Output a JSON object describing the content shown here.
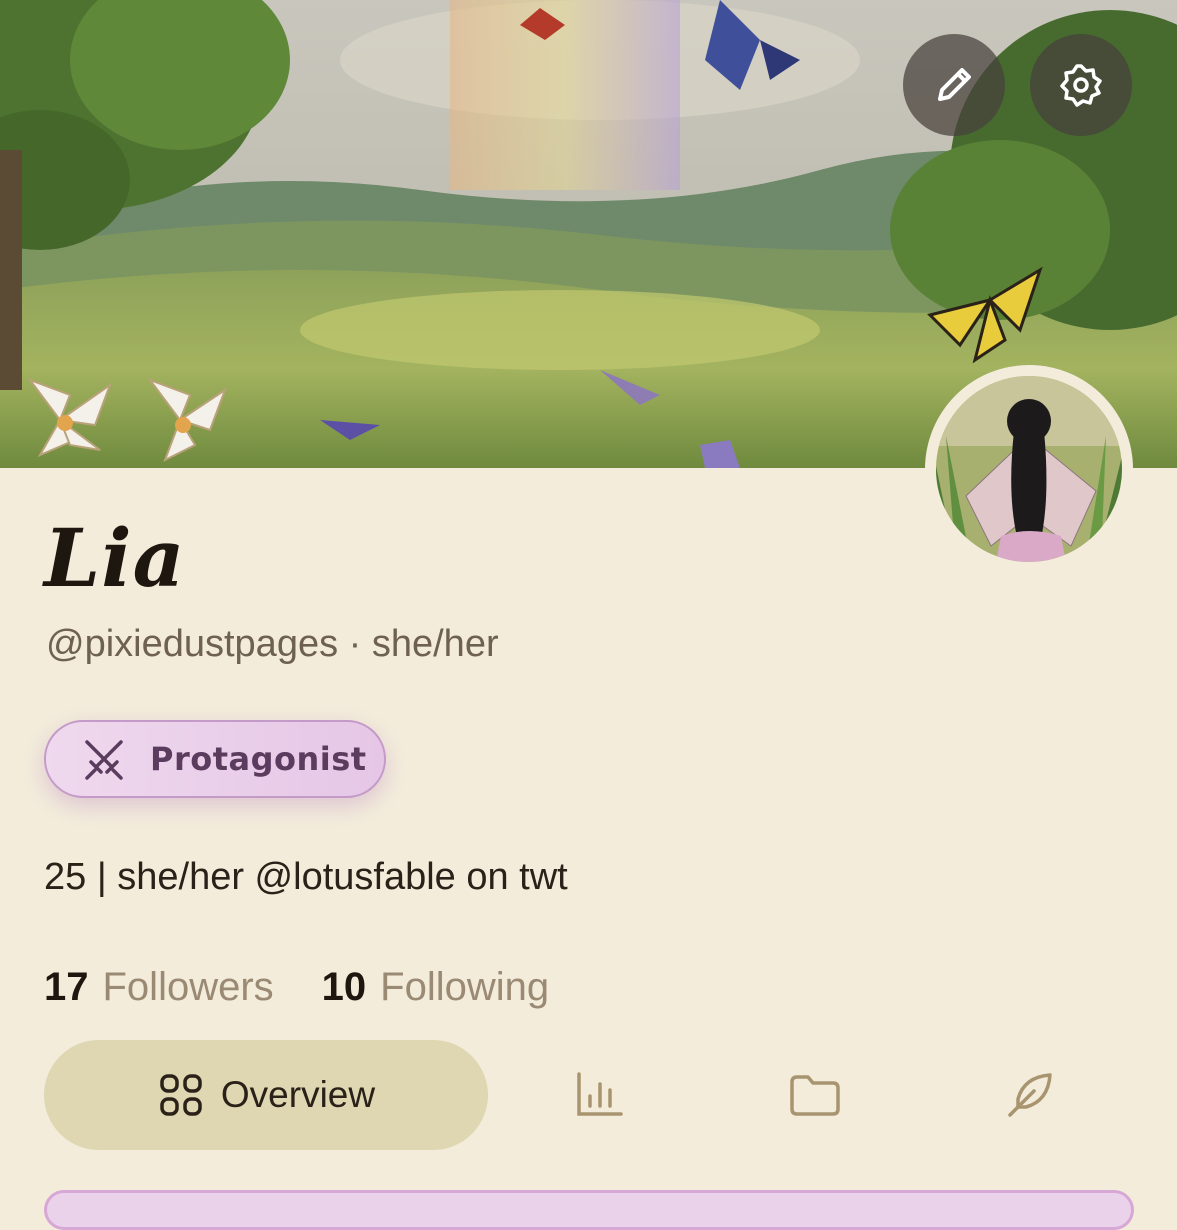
{
  "profile": {
    "display_name": "Lia",
    "handle_line": "@pixiedustpages · she/her",
    "badge": {
      "icon": "crossed-swords-icon",
      "label": "Protagonist"
    },
    "bio": "25 | she/her @lotusfable on twt"
  },
  "stats": {
    "followers_count": "17",
    "followers_label": "Followers",
    "following_count": "10",
    "following_label": "Following"
  },
  "header_actions": [
    {
      "icon": "pencil-icon",
      "label": "Edit profile"
    },
    {
      "icon": "gear-icon",
      "label": "Settings"
    }
  ],
  "tabs": [
    {
      "icon": "grid-icon",
      "label": "Overview",
      "active": true
    },
    {
      "icon": "bar-chart-icon",
      "label": "",
      "active": false
    },
    {
      "icon": "folder-icon",
      "label": "",
      "active": false
    },
    {
      "icon": "feather-icon",
      "label": "",
      "active": false
    }
  ],
  "colors": {
    "background": "#f3ecdb",
    "active_tab": "#dfd6b2",
    "badge_border": "#c49ac8",
    "badge_text": "#5b3c5f",
    "muted_text": "#9a8a73"
  }
}
